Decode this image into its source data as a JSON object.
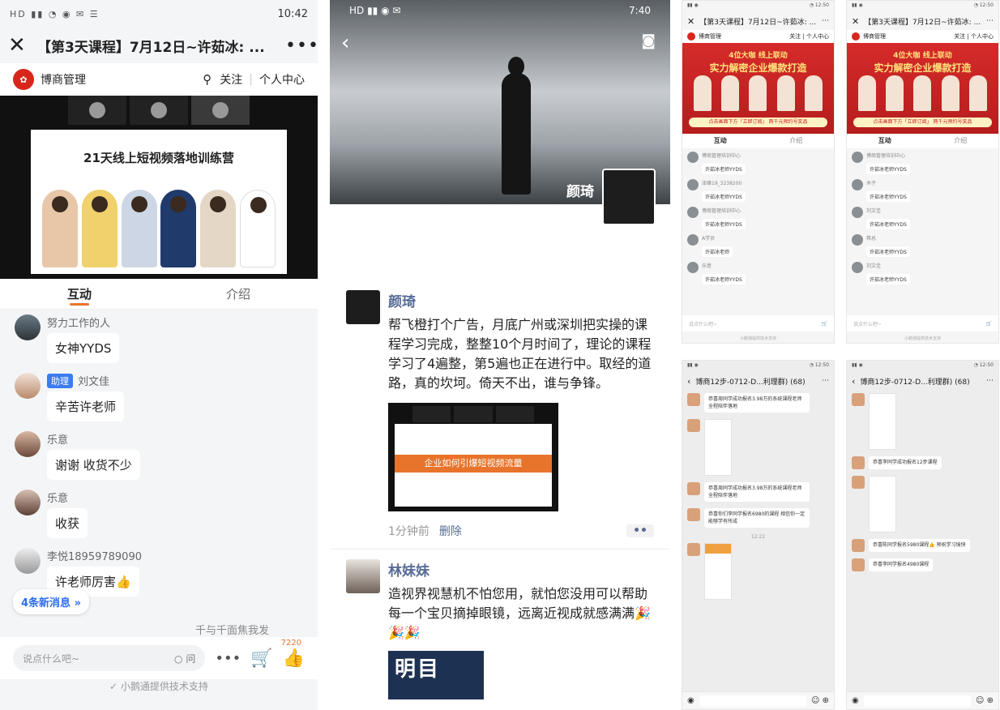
{
  "panel_a": {
    "status_time": "10:42",
    "title": "【第3天课程】7月12日~许茹冰: ...",
    "brand": "博商管理",
    "follow": "关注",
    "personal_center": "个人中心",
    "slide_title": "21天线上短视频落地训练营",
    "tabs": [
      "互动",
      "介绍"
    ],
    "messages": [
      {
        "user": "努力工作的人",
        "text": "女神YYDS",
        "tag": ""
      },
      {
        "user": "刘文佳",
        "text": "辛苦许老师",
        "tag": "助理"
      },
      {
        "user": "乐意",
        "text": "谢谢 收货不少",
        "tag": ""
      },
      {
        "user": "乐意",
        "text": "收获",
        "tag": ""
      },
      {
        "user": "李悦18959789090",
        "text": "许老师厉害👍",
        "tag": ""
      }
    ],
    "new_messages": "4条新消息",
    "partial_user": "千与千面焦我发",
    "input_placeholder": "说点什么吧~",
    "ask_label": "问",
    "like_count": "7220",
    "support": "小鹅通提供技术支持"
  },
  "panel_b": {
    "status_time": "7:40",
    "hero_name": "颜琦",
    "post1": {
      "author": "颜琦",
      "text": "帮飞橙打个广告，月底广州或深圳把实操的课程学习完成，整整10个月时间了，理论的课程学习了4遍整，第5遍也正在进行中。取经的道路，真的坎坷。倚天不出，谁与争锋。",
      "image_banner": "企业如何引爆短视频流量",
      "time": "1分钟前",
      "delete": "删除",
      "options": "••"
    },
    "post2": {
      "author": "林妹妹",
      "text": "造视界视慧机不怕您用，就怕您没用可以帮助每一个宝贝摘掉眼镜，远离近视成就感满满🎉🎉🎉",
      "image_text": "明目"
    }
  },
  "panel_c": {
    "live_title": "【第3天课程】7月12日~许茹冰: ...",
    "live_brand": "博商管理",
    "live_follow": "关注",
    "live_center": "个人中心",
    "poster_line1": "4位大咖 线上联动",
    "poster_line2": "实力解密企业爆款打造",
    "poster_cta": "点击画面下方「立即订阅」 两千元预约号奖品",
    "tabs": [
      "互动",
      "介绍"
    ],
    "chat_a": [
      {
        "user": "博商管理培训中心",
        "text": "许茹冰老师YYDS"
      },
      {
        "user": "泽峰19_3238200",
        "text": "许茹冰老师YYDS"
      },
      {
        "user": "博商管理培训中心",
        "text": "许茹冰老师YYDS"
      },
      {
        "user": "A学员",
        "text": "许茹冰老师"
      },
      {
        "user": "乐意",
        "text": "许茹冰老师YYDS"
      }
    ],
    "chat_b": [
      {
        "user": "博商管理培训中心",
        "text": "许茹冰老师YYDS"
      },
      {
        "user": "木子",
        "text": "许茹冰老师YYDS"
      },
      {
        "user": "刘文佳",
        "text": "许茹冰老师YYDS"
      },
      {
        "user": "蒋总",
        "text": "许茹冰老师YYDS"
      },
      {
        "user": "刘文佳",
        "text": "许茹冰老师YYDS"
      }
    ],
    "input_placeholder": "说点什么吧~",
    "support": "小鹅通提供技术支持",
    "group_title": "博商12步-0712-D...利理群) (68)",
    "group_a_msgs": [
      "恭喜周同学成功报名3.98万的系统课程老师全程陪伴落地",
      "恭喜周同学成功报名3.98万的系统课程老师全程陪伴落地",
      "恭喜你们李同学报名6980的课程 相信你一定能够学有所成"
    ],
    "group_b_msgs": [
      "恭喜李同学成功报名12步课程",
      "恭喜陈同学报名5980课程👍 预祝学习愉快",
      "恭喜李同学报名4980课程"
    ],
    "time_label": "12:22"
  }
}
